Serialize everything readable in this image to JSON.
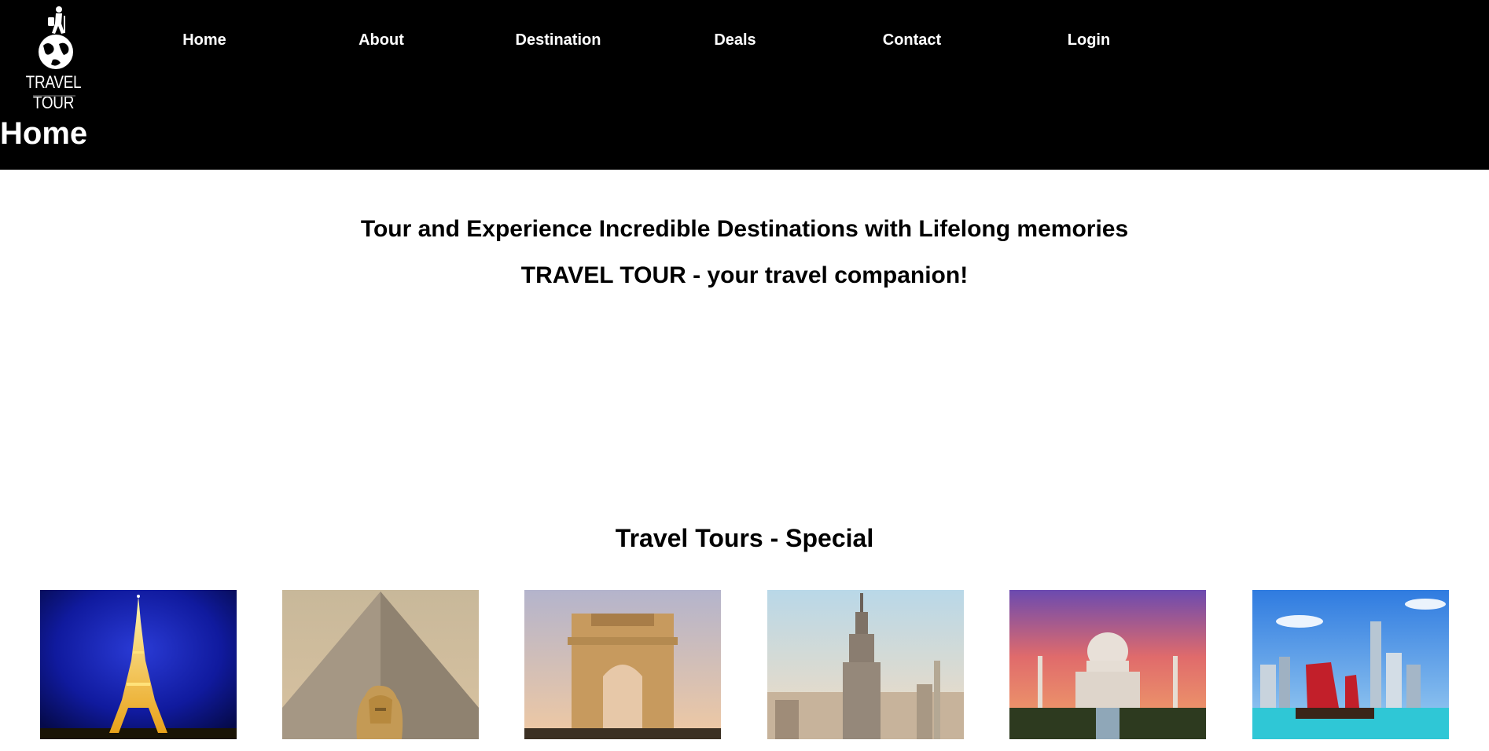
{
  "logo": {
    "text": "TRAVEL TOUR",
    "icon": "globe-with-traveler-icon"
  },
  "nav": {
    "items": [
      "Home",
      "About",
      "Destination",
      "Deals",
      "Contact",
      "Login"
    ]
  },
  "page_title": "Home",
  "hero": {
    "line1": "Tour and Experience Incredible Destinations with Lifelong memories",
    "line2": "TRAVEL TOUR - your travel companion!"
  },
  "special": {
    "title": "Travel Tours - Special",
    "tours": [
      {
        "image": "eiffel-tower-night"
      },
      {
        "image": "pyramid-and-sphinx"
      },
      {
        "image": "india-gate"
      },
      {
        "image": "empire-state-building"
      },
      {
        "image": "taj-mahal-sunset"
      },
      {
        "image": "hong-kong-harbor-junk-boat"
      }
    ]
  },
  "colors": {
    "header_bg": "#000000",
    "header_text": "#ffffff",
    "body_text": "#000000",
    "page_bg": "#ffffff"
  }
}
